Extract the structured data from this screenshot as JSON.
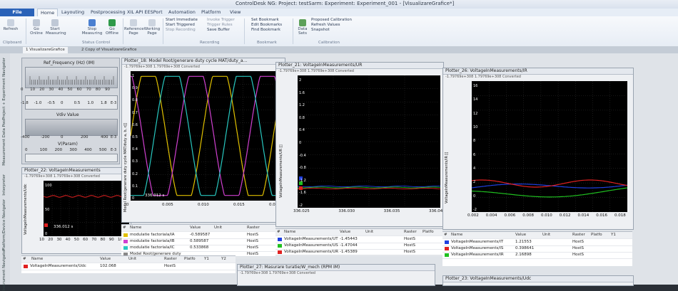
{
  "window": {
    "title": "ControlDesk NG: Project: testSarm: Experiment: Experiment_001 - [VisualizareGrafice*]"
  },
  "ribbon_tabs": [
    {
      "label": "File"
    },
    {
      "label": "Home"
    },
    {
      "label": "Layouting"
    },
    {
      "label": "Postprocessing"
    },
    {
      "label": "XIL API EESPort"
    },
    {
      "label": "Automation"
    },
    {
      "label": "Platform"
    },
    {
      "label": "View"
    }
  ],
  "ribbon": {
    "refresh": "Refresh",
    "go_online": "Go Online",
    "start_measuring": "Start Measuring",
    "stop_measuring": "Stop Measuring",
    "go_offline": "Go Offline",
    "reference_page": "Reference Page",
    "working_page": "Working Page",
    "start_immediate": "Start Immediate",
    "start_triggered": "Start Triggered",
    "stop_recording": "Stop Recording",
    "invoke_trigger": "Invoke Trigger",
    "trigger_rules": "Trigger Rules",
    "save_buffer": "Save Buffer",
    "set_bookmark": "Set Bookmark",
    "edit_bookmarks": "Edit Bookmarks",
    "find_bookmark": "Find Bookmark",
    "data_sets": "Data Sets",
    "proposed_calibration": "Proposed Calibration",
    "refresh_values": "Refresh Values",
    "snapshot": "Snapshot",
    "grp_clipboard": "Clipboard",
    "grp_status": "Status Control",
    "grp_recording": "Recording",
    "grp_bookmark": "Bookmark",
    "grp_calibration": "Calibration"
  },
  "doc_tabs": [
    "1 VisualizareGrafice",
    "2 Copy of VisualizareGrafice"
  ],
  "left_nav": [
    "Project + Experiment Navigator",
    "Measurement Data Pool",
    "Interpreter",
    "Platform/Device Navigator",
    "Instrument Navigator"
  ],
  "instruments": {
    "freq_title": "Ref_Frequency (Hz) (IM)",
    "freq_ticks": [
      "0",
      "10",
      "20",
      "30",
      "40",
      "50",
      "60",
      "70",
      "80",
      "90"
    ],
    "freq_scale2": [
      "-1.8",
      "-1.0",
      "-0.5",
      "0",
      "0.5",
      "1.0",
      "1.8"
    ],
    "freq_exp": "E-3",
    "vdiv_title": "Vdiv Value",
    "vdiv_ticks": [
      "-400",
      "-200",
      "0",
      "200",
      "400"
    ],
    "vdiv_exp": "E-3",
    "vpar_title": "V(Param)",
    "vpar_ticks": [
      "0",
      "100",
      "200",
      "300",
      "400",
      "500"
    ],
    "vpar_exp": "E-3"
  },
  "plotter_18": {
    "title": "Plotter_18: Model Root/generare duty cycle MAT/duty_a...",
    "range": "-1.79769e+308  1.79769e+308  Converted",
    "ylabel": "Model Root/generare duty cycle MAT/duty a, b, c[]",
    "yticks": [
      "1",
      "0.9",
      "0.8",
      "0.7",
      "0.6",
      "0.5",
      "0.4",
      "0.3",
      "0.2",
      "0.1",
      "0"
    ],
    "xticks": [
      "0",
      "0.005",
      "0.010",
      "0.015",
      "0.02"
    ],
    "cursor": "336.012 s",
    "columns": [
      "#",
      "Name",
      "Value",
      "Unit",
      "Raster",
      "Platfo"
    ],
    "rows": [
      {
        "name": "modulatie factoriala/IA",
        "value": "-0.589587",
        "raster": "HostS",
        "color": "#e0c000"
      },
      {
        "name": "modulatie factoriala/IB",
        "value": "0.589587",
        "raster": "HostS",
        "color": "#d040d0"
      },
      {
        "name": "modulatie factoriala/IC",
        "value": "0.533868",
        "raster": "HostS",
        "color": "#28c8c0"
      },
      {
        "name": "Model Root/generare duty",
        "value": "",
        "raster": "HostS",
        "color": "#888888"
      }
    ]
  },
  "plotter_21": {
    "title": "Plotter_21: VoltageInMeasurements/UR",
    "range": "-1.79769e+308  1.79769e+308  Converted",
    "ylabel": "VoltageInMeasurements/UR []",
    "yticks": [
      "2",
      "1.6",
      "1.2",
      "0.8",
      "0.4",
      "0",
      "-0.4",
      "-0.8",
      "-1.2",
      "-1.6",
      "-2"
    ],
    "xticks": [
      "336.025",
      "336.030",
      "336.035",
      "336.040"
    ],
    "columns": [
      "#",
      "Name",
      "Value",
      "Unit",
      "Raster",
      "Platfo"
    ],
    "rows": [
      {
        "name": "VoltageInMeasurements/UT",
        "value": "-1.45443",
        "raster": "HostS",
        "color": "#2040e0"
      },
      {
        "name": "VoltageInMeasurements/US",
        "value": "-1.47044",
        "raster": "HostS",
        "color": "#20c020"
      },
      {
        "name": "VoltageInMeasurements/UR",
        "value": "-1.45389",
        "raster": "HostS",
        "color": "#e02020"
      }
    ]
  },
  "plotter_26": {
    "title": "Plotter_26: VoltageInMeasurements/IR",
    "range": "-1.79769e+308  1.79769e+308  Converted",
    "ylabel": "VoltageInMeasurements/IR []",
    "yticks": [
      "16",
      "14",
      "12",
      "10",
      "8",
      "6",
      "4",
      "2",
      "0",
      "-2"
    ],
    "xticks": [
      "0.002",
      "0.004",
      "0.006",
      "0.008",
      "0.010",
      "0.012",
      "0.014",
      "0.016",
      "0.018"
    ],
    "columns": [
      "#",
      "Name",
      "Value",
      "Unit",
      "Raster",
      "Platfo",
      "Y1"
    ],
    "rows": [
      {
        "name": "VoltageInMeasurements/IT",
        "value": "1.21553",
        "raster": "HostS",
        "color": "#2040e0"
      },
      {
        "name": "VoltageInMeasurements/IS",
        "value": "0.398641",
        "raster": "HostS",
        "color": "#e02020"
      },
      {
        "name": "VoltageInMeasurements/IR",
        "value": "2.16898",
        "raster": "HostS",
        "color": "#20c020"
      }
    ]
  },
  "plotter_22": {
    "title": "Plotter_22: VoltageInMeasurements",
    "range": "-1.79769e+308  1.79769e+308  Converted",
    "ylabel": "VoltageInMeasurements/Udc",
    "yticks": [
      "100",
      "50",
      "0"
    ],
    "xticks": [
      "10",
      "20",
      "30",
      "40",
      "50",
      "60",
      "70",
      "80",
      "90",
      "100"
    ],
    "cursor": "336.012 s",
    "columns": [
      "#",
      "Name",
      "Value",
      "Unit",
      "Raster",
      "Platfo",
      "Y1",
      "Y2"
    ],
    "rows": [
      {
        "name": "VoltageInMeasurements/Udc",
        "value": "102.068",
        "raster": "HostS",
        "color": "#e02020"
      }
    ]
  },
  "plotter_27": {
    "title": "Plotter_27: Masurare turatie/W_mech (RPM IM)",
    "range": "-1.79769e+308  1.79769e+308  Converted"
  },
  "plotter_23": {
    "title": "Plotter_23: VoltageInMeasurements/Udc"
  }
}
